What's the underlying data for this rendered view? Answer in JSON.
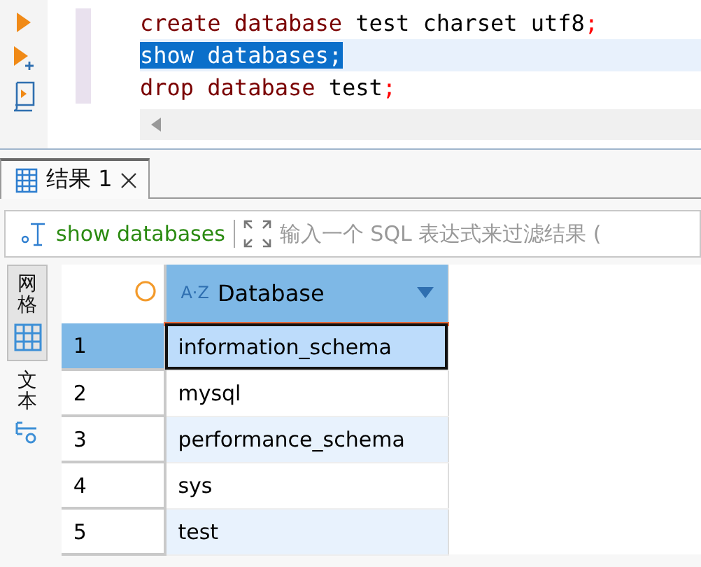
{
  "editor": {
    "lines": [
      {
        "selected": false,
        "tokens": [
          {
            "kind": "keyword",
            "text": "create database"
          },
          {
            "kind": "plain",
            "text": " test charset utf8"
          },
          {
            "kind": "punct",
            "text": ";"
          }
        ]
      },
      {
        "selected": true,
        "tokens": [
          {
            "kind": "keyword",
            "text": "show databases;"
          }
        ]
      },
      {
        "selected": false,
        "tokens": [
          {
            "kind": "keyword",
            "text": "drop database"
          },
          {
            "kind": "plain",
            "text": " test"
          },
          {
            "kind": "punct",
            "text": ";"
          }
        ]
      }
    ]
  },
  "result_tabs": [
    {
      "label": "结果 1",
      "selected": true
    }
  ],
  "filter": {
    "query": "show databases",
    "placeholder": "输入一个 SQL 表达式来过滤结果 ("
  },
  "view_tabs": [
    {
      "label": "网格",
      "kind": "grid",
      "selected": true
    },
    {
      "label": "文本",
      "kind": "text",
      "selected": false
    }
  ],
  "table": {
    "columns": [
      {
        "sort_label": "A·Z",
        "label": "Database"
      }
    ],
    "rows": [
      {
        "number": "1",
        "cells": [
          "information_schema"
        ],
        "selected": true
      },
      {
        "number": "2",
        "cells": [
          "mysql"
        ],
        "selected": false
      },
      {
        "number": "3",
        "cells": [
          "performance_schema"
        ],
        "selected": false
      },
      {
        "number": "4",
        "cells": [
          "sys"
        ],
        "selected": false
      },
      {
        "number": "5",
        "cells": [
          "test"
        ],
        "selected": false
      }
    ]
  }
}
